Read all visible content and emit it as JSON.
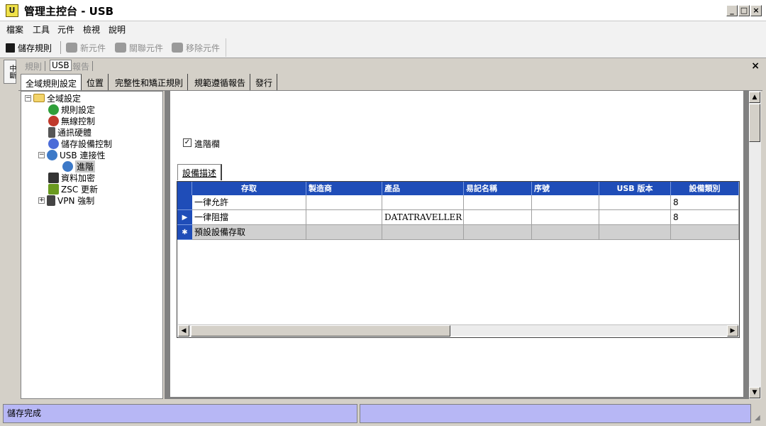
{
  "window": {
    "title": "管理主控台 - USB",
    "icon_glyph": "U",
    "controls": {
      "minimize": "_",
      "maximize": "□",
      "close": "×"
    }
  },
  "menubar": {
    "items": [
      "檔案",
      "工具",
      "元件",
      "檢視",
      "說明"
    ]
  },
  "toolbar": {
    "save_label": "儲存規則",
    "new_component_label": "新元件",
    "link_component_label": "關聯元件",
    "remove_component_label": "移除元件"
  },
  "left_strip": {
    "tab_label": "中斷"
  },
  "top_tabs": {
    "items": [
      {
        "label": "規則",
        "active": false
      },
      {
        "label": "USB",
        "active": true
      },
      {
        "label": "報告",
        "active": false
      }
    ],
    "close_glyph": "×"
  },
  "secondary_tabs": {
    "items": [
      {
        "label": "全域規則設定",
        "active": true
      },
      {
        "label": "位置",
        "active": false
      },
      {
        "label": "完整性和矯正規則",
        "active": false
      },
      {
        "label": "規範遵循報告",
        "active": false
      },
      {
        "label": "發行",
        "active": false
      }
    ]
  },
  "tree": {
    "root": "全域設定",
    "items": [
      {
        "label": "規則設定",
        "icon": "globe-icon",
        "color": "#2f9f3a"
      },
      {
        "label": "無線控制",
        "icon": "wireless-icon",
        "color": "#c0392b"
      },
      {
        "label": "通訊硬體",
        "icon": "hardware-icon",
        "color": "#555555"
      },
      {
        "label": "儲存設備控制",
        "icon": "storage-icon",
        "color": "#4b6cd8"
      },
      {
        "label": "USB 連接性",
        "icon": "usb-icon",
        "color": "#3c79c8"
      },
      {
        "label": "進階",
        "icon": "usb-advanced-icon",
        "color": "#3c79c8",
        "selected": true
      },
      {
        "label": "資料加密",
        "icon": "encryption-icon",
        "color": "#333333"
      },
      {
        "label": "ZSC 更新",
        "icon": "update-icon",
        "color": "#6a9a1f"
      },
      {
        "label": "VPN 強制",
        "icon": "vpn-icon",
        "color": "#444444"
      }
    ],
    "toggle_expanded": "−",
    "toggle_collapsed": "+"
  },
  "content": {
    "checkbox_label": "進階欄",
    "checkbox_checked": true,
    "checkbox_glyph": "✓",
    "device_tab_label": "設備描述"
  },
  "grid": {
    "columns": [
      "存取",
      "製造商",
      "產品",
      "易記名稱",
      "序號",
      "USB 版本",
      "設備類別"
    ],
    "rows": [
      {
        "indicator": "",
        "cells": [
          "一律允許",
          "",
          "",
          "",
          "",
          "",
          "8"
        ]
      },
      {
        "indicator": "▶",
        "cells": [
          "一律阻擋",
          "",
          "DATATRAVELLER",
          "",
          "",
          "",
          "8"
        ]
      }
    ],
    "new_row": {
      "indicator": "✱",
      "cells": [
        "預設設備存取",
        "",
        "",
        "",
        "",
        "",
        ""
      ]
    }
  },
  "statusbar": {
    "message": "儲存完成",
    "second_pane": ""
  },
  "colors": {
    "grid_header": "#1f4db8",
    "status_pane": "#b7b7f5",
    "window_bg": "#d4d0c8"
  }
}
